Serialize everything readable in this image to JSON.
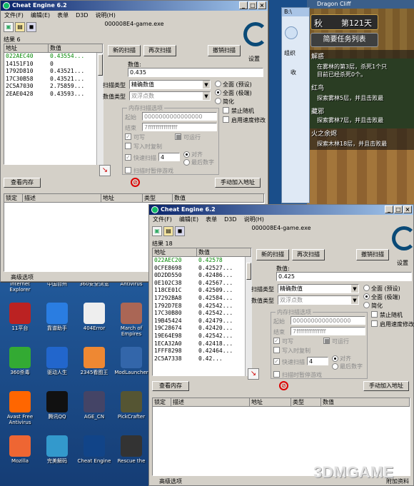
{
  "desktop": {
    "top_labels": [
      "Internet\nExplorer",
      "中国台州",
      "360安全浏览",
      "Antivirus"
    ],
    "icons": [
      {
        "label": "11平台",
        "color": "#b22"
      },
      {
        "label": "靠谱助手",
        "color": "#2a7de1"
      },
      {
        "label": "404Error",
        "color": "#eee"
      },
      {
        "label": "March of\nEmpires",
        "color": "#a65"
      },
      {
        "label": "360杀毒",
        "color": "#3a3"
      },
      {
        "label": "驱动人生",
        "color": "#26c"
      },
      {
        "label": "2345看图王",
        "color": "#e83"
      },
      {
        "label": "ModLauncher",
        "color": "#36a"
      },
      {
        "label": "Avast Free\nAntivirus",
        "color": "#f60"
      },
      {
        "label": "腾讯QQ",
        "color": "#111"
      },
      {
        "label": "AGE_CN",
        "color": "#446"
      },
      {
        "label": "PickCrafter",
        "color": "#553"
      },
      {
        "label": "Mozilla",
        "color": "#e63"
      },
      {
        "label": "完美解码",
        "color": "#39c"
      },
      {
        "label": "Cheat Engine",
        "color": "#148"
      },
      {
        "label": "Rescue the",
        "color": "#333"
      }
    ]
  },
  "game": {
    "title": "Dragon Cliff",
    "season": "秋",
    "day": "第121天",
    "task_button": "简要任务列表",
    "lines": [
      "解惑",
      "在雾林的第3层，杀死1个只",
      "目前已经杀死0个。",
      "红鸟",
      "探索雾林5层，并且击败最",
      "藏邪",
      "探索雾林7层，并且击败最",
      "火之余烬",
      "探索木林18层，并且击败最"
    ]
  },
  "explorer": {
    "title": "B:\\",
    "org": "组织",
    "item": "收"
  },
  "win1": {
    "title": "Cheat Engine 6.2",
    "menu": [
      "文件(F)",
      "编辑(E)",
      "表单",
      "D3D",
      "说明(H)"
    ],
    "process": "000008E4-game.exe",
    "results_label": "结果",
    "results_count": "6",
    "col_addr": "地址",
    "col_val": "数值",
    "rows": [
      {
        "addr": "022AEC40",
        "val": "0.43554...",
        "green": true
      },
      {
        "addr": "14151F10",
        "val": "0",
        "green": false
      },
      {
        "addr": "1792D810",
        "val": "0.43521...",
        "green": false
      },
      {
        "addr": "17C30B58",
        "val": "0.43521...",
        "green": false
      },
      {
        "addr": "2C5A7030",
        "val": "2.75859...",
        "green": false
      },
      {
        "addr": "2EAE0428",
        "val": "0.43593...",
        "green": false
      }
    ],
    "new_scan": "新的扫描",
    "next_scan": "再次扫描",
    "undo_scan": "撤销扫描",
    "settings": "设置",
    "value_label": "数值:",
    "value": "0.435",
    "scan_type_label": "扫描类型",
    "scan_type": "精确数值",
    "value_type_label": "数值类型",
    "value_type": "双浮点数",
    "mem_opts": "内存扫描选项",
    "start_label": "起始",
    "start": "0000000000000000",
    "end_label": "结束",
    "end": "7fffffffffffffff",
    "writable": "可写",
    "executable": "可运行",
    "copy_on_write": "写入时复制",
    "fast_scan": "快速扫描",
    "fast_val": "4",
    "align": "对齐",
    "last_digits": "最后数字",
    "pause": "扫描时暂停游戏",
    "all_default": "全面 (预设)",
    "all_chain": "全面 (极端)",
    "simple": "简化",
    "no_random": "禁止随机",
    "speedhack": "启用速度修改",
    "view_mem": "查看内存",
    "add_addr": "手动加入地址",
    "tbl_lock": "锁定",
    "tbl_desc": "描述",
    "tbl_addr": "地址",
    "tbl_type": "类型",
    "tbl_val": "数值",
    "adv": "高级选项"
  },
  "win2": {
    "title": "Cheat Engine 6.2",
    "menu": [
      "文件(F)",
      "编辑(E)",
      "表单",
      "D3D",
      "说明(H)"
    ],
    "process": "000008E4-game.exe",
    "results_label": "结果",
    "results_count": "18",
    "col_addr": "地址",
    "col_val": "数值",
    "rows": [
      {
        "addr": "022AEC20",
        "val": "0.42578",
        "green": true
      },
      {
        "addr": "0CFE8698",
        "val": "0.42527...",
        "green": false
      },
      {
        "addr": "0D2DD550",
        "val": "0.42486...",
        "green": false
      },
      {
        "addr": "0E102C38",
        "val": "0.42567...",
        "green": false
      },
      {
        "addr": "118CE01C",
        "val": "0.42509...",
        "green": false
      },
      {
        "addr": "17292BA8",
        "val": "0.42584...",
        "green": false
      },
      {
        "addr": "1792D7E8",
        "val": "0.42542...",
        "green": false
      },
      {
        "addr": "17C30B80",
        "val": "0.42542...",
        "green": false
      },
      {
        "addr": "19B45424",
        "val": "0.42479...",
        "green": false
      },
      {
        "addr": "19C28674",
        "val": "0.42420...",
        "green": false
      },
      {
        "addr": "19E64E98",
        "val": "0.42542...",
        "green": false
      },
      {
        "addr": "1ECA32A0",
        "val": "0.42418...",
        "green": false
      },
      {
        "addr": "1FFF8298",
        "val": "0.42464...",
        "green": false
      },
      {
        "addr": "2C5A7338",
        "val": "0.42...",
        "green": false
      }
    ],
    "new_scan": "新的扫描",
    "next_scan": "再次扫描",
    "undo_scan": "撤销扫描",
    "settings": "设置",
    "value_label": "数值:",
    "value": "0.425",
    "scan_type_label": "扫描类型",
    "scan_type": "精确数值",
    "value_type_label": "数值类型",
    "value_type": "双浮点数",
    "mem_opts": "内存扫描选项",
    "start_label": "起始",
    "start": "0000000000000000",
    "end_label": "结束",
    "end": "7fffffffffffffff",
    "writable": "可写",
    "executable": "可运行",
    "copy_on_write": "写入时复制",
    "fast_scan": "快速扫描",
    "fast_val": "4",
    "align": "对齐",
    "last_digits": "最后数字",
    "pause": "扫描时暂停游戏",
    "all_default": "全面 (预设)",
    "all_chain": "全面 (极端)",
    "simple": "简化",
    "no_random": "禁止随机",
    "speedhack": "启用速度修改",
    "view_mem": "查看内存",
    "add_addr": "手动加入地址",
    "tbl_lock": "锁定",
    "tbl_desc": "描述",
    "tbl_addr": "地址",
    "tbl_type": "类型",
    "tbl_val": "数值",
    "adv": "高级选项",
    "watermark": "3DMGAME",
    "status": "附加资料"
  }
}
